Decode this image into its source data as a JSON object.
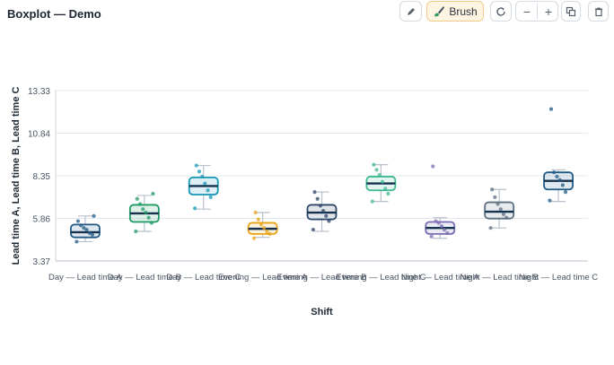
{
  "title": "Boxplot — Demo",
  "toolbar": {
    "buttons": [
      {
        "name": "pen-tool-button",
        "icon": "pen-icon",
        "label": ""
      },
      {
        "name": "brush-button",
        "icon": "brush-icon",
        "label": "Brush",
        "active": true
      },
      {
        "name": "reset-button",
        "icon": "refresh-icon",
        "label": ""
      },
      {
        "name": "zoom-out-button",
        "icon": "minus-icon",
        "label": "−"
      },
      {
        "name": "zoom-in-button",
        "icon": "plus-icon",
        "label": "+"
      },
      {
        "name": "copy-button",
        "icon": "copy-icon",
        "label": ""
      },
      {
        "name": "delete-button",
        "icon": "trash-icon",
        "label": ""
      }
    ]
  },
  "chart_data": {
    "type": "boxplot",
    "xlabel": "Shift",
    "ylabel": "Lead time A, Lead time B, Lead time C",
    "ylim": [
      3.37,
      14.9
    ],
    "yticks": [
      "3.37",
      "5.86",
      "8.35",
      "10.84",
      "13.33"
    ],
    "grid": true,
    "categories": [
      "Day — Lead time A",
      "Day — Lead time B",
      "Day — Lead time C",
      "Evening — Lead time A",
      "Evening — Lead time B",
      "Evening — Lead time C",
      "Night — Lead time A",
      "Night — Lead time B",
      "Night — Lead time C"
    ],
    "boxes": [
      {
        "color": "#1f5a85",
        "whisker_low": 4.5,
        "q1": 4.75,
        "median": 5.05,
        "q3": 5.5,
        "whisker_high": 6.0,
        "points": [
          4.5,
          4.9,
          5.0,
          5.2,
          5.3,
          5.45,
          5.7,
          6.0
        ]
      },
      {
        "color": "#1e9a62",
        "whisker_low": 5.1,
        "q1": 5.65,
        "median": 6.15,
        "q3": 6.65,
        "whisker_high": 7.2,
        "points": [
          5.1,
          5.6,
          5.9,
          6.2,
          6.4,
          6.7,
          7.0,
          7.3
        ]
      },
      {
        "color": "#1597b5",
        "whisker_low": 6.4,
        "q1": 7.25,
        "median": 7.75,
        "q3": 8.25,
        "whisker_high": 8.95,
        "points": [
          6.45,
          7.1,
          7.5,
          7.9,
          8.3,
          8.6,
          8.95
        ]
      },
      {
        "color": "#e8a415",
        "whisker_low": 4.75,
        "q1": 4.95,
        "median": 5.25,
        "q3": 5.6,
        "whisker_high": 6.2,
        "points": [
          4.7,
          4.95,
          5.1,
          5.3,
          5.5,
          5.8,
          6.2
        ]
      },
      {
        "color": "#2b4668",
        "whisker_low": 5.1,
        "q1": 5.8,
        "median": 6.2,
        "q3": 6.65,
        "whisker_high": 7.4,
        "points": [
          5.2,
          5.7,
          6.0,
          6.3,
          6.6,
          7.0,
          7.4
        ]
      },
      {
        "color": "#3db892",
        "whisker_low": 6.85,
        "q1": 7.5,
        "median": 7.9,
        "q3": 8.3,
        "whisker_high": 9.0,
        "points": [
          6.85,
          7.3,
          7.6,
          8.0,
          8.4,
          8.7,
          9.0
        ]
      },
      {
        "color": "#7b6bb2",
        "whisker_low": 4.7,
        "q1": 4.95,
        "median": 5.3,
        "q3": 5.65,
        "whisker_high": 5.9,
        "points": [
          4.8,
          5.0,
          5.2,
          5.4,
          5.6,
          5.7,
          8.9
        ]
      },
      {
        "color": "#5e6e82",
        "whisker_low": 5.3,
        "q1": 5.85,
        "median": 6.25,
        "q3": 6.8,
        "whisker_high": 7.55,
        "points": [
          5.3,
          5.9,
          6.1,
          6.4,
          6.7,
          7.1,
          7.55
        ]
      },
      {
        "color": "#1f5a85",
        "whisker_low": 6.85,
        "q1": 7.55,
        "median": 8.05,
        "q3": 8.55,
        "whisker_high": 8.7,
        "points": [
          6.9,
          7.4,
          7.8,
          8.1,
          8.3,
          8.55,
          12.25
        ]
      }
    ]
  }
}
